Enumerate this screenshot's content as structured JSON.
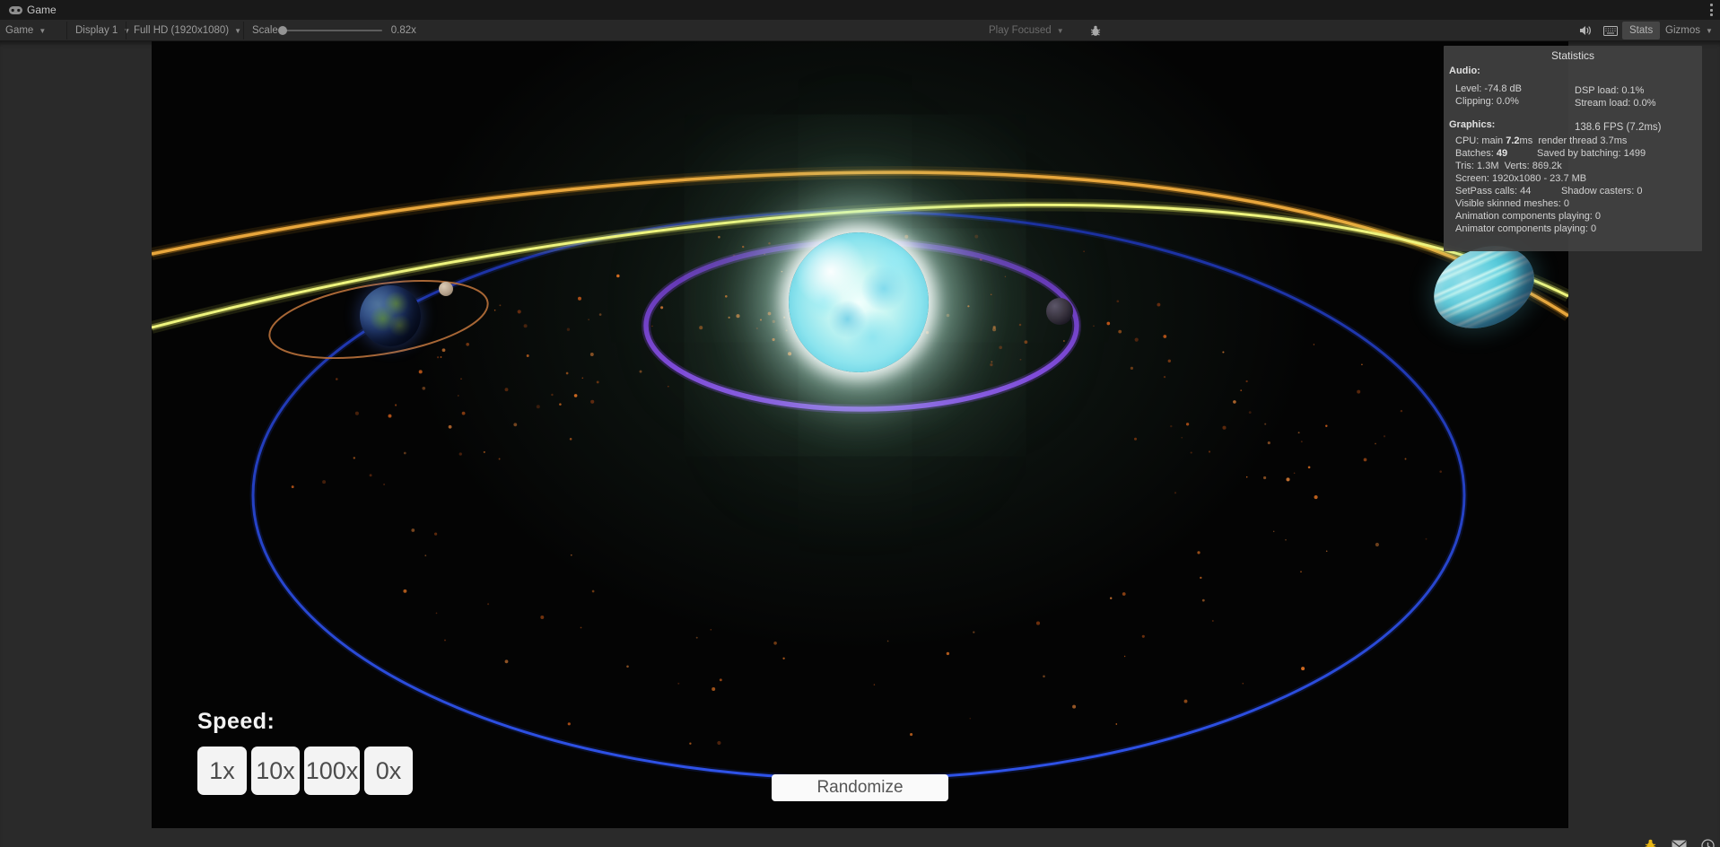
{
  "window": {
    "tab_label": "Game"
  },
  "toolbar": {
    "mode_dropdown": "Game",
    "display_dropdown": "Display 1",
    "resolution_dropdown": "Full HD (1920x1080)",
    "scale_label": "Scale",
    "scale_value": "0.82x",
    "play_focused": "Play Focused",
    "stats_label": "Stats",
    "gizmos_label": "Gizmos"
  },
  "stats_panel": {
    "title": "Statistics",
    "audio_heading": "Audio:",
    "audio_level": "Level: -74.8 dB",
    "audio_clipping": "Clipping: 0.0%",
    "audio_dsp": "DSP load: 0.1%",
    "audio_stream": "Stream load: 0.0%",
    "graphics_heading": "Graphics:",
    "fps": "138.6 FPS (7.2ms)",
    "cpu_prefix": "CPU: main ",
    "cpu_bold": "7.2",
    "cpu_suffix": "ms  render thread 3.7ms",
    "batches_prefix": "Batches: ",
    "batches_bold": "49",
    "batches_saved": "Saved by batching: 1499",
    "tris_verts": "Tris: 1.3M  Verts: 869.2k",
    "screen": "Screen: 1920x1080 - 23.7 MB",
    "setpass": "SetPass calls: 44",
    "shadow_casters": "Shadow casters: 0",
    "visible_skinned": "Visible skinned meshes: 0",
    "animation_playing": "Animation components playing: 0",
    "animator_playing": "Animator components playing: 0"
  },
  "hud": {
    "speed_label": "Speed:",
    "speed_buttons": [
      "1x",
      "10x",
      "100x",
      "0x"
    ],
    "randomize_label": "Randomize"
  },
  "scene": {
    "colors": {
      "star_core": "#eafffb",
      "star_glow": "#9fe8c8",
      "orbit_purple": "#8a52e8",
      "orbit_blue": "#2a46d8",
      "moon_orbit": "#b06c38",
      "outer_arc_orange": "#d89020",
      "outer_arc_yellow": "#e9ef6e",
      "asteroid": "#b85418"
    },
    "objects": [
      "star",
      "earth",
      "moon",
      "moon-orbit",
      "purple-orbit",
      "purple-orbit-moon",
      "blue-orbit",
      "striped-gas-planet",
      "asteroid-belt",
      "outer-arc-orange",
      "outer-arc-yellow"
    ]
  }
}
